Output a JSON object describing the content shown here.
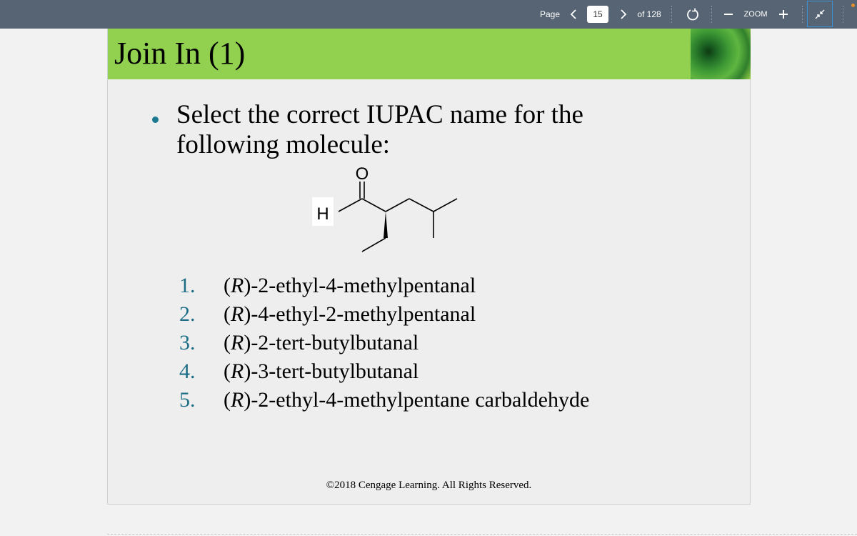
{
  "toolbar": {
    "page_label": "Page",
    "current_page": "15",
    "total_pages_label": "of 128",
    "zoom_label": "ZOOM",
    "prev_icon": "chevron-left-icon",
    "next_icon": "chevron-right-icon",
    "rotate_icon": "rotate-icon",
    "zoom_out_icon": "minus-icon",
    "zoom_in_icon": "plus-icon",
    "fit_icon": "collapse-arrows-icon",
    "accent_color": "#3e8fd0",
    "notification_color": "#e8902a"
  },
  "slide": {
    "title": "Join In (1)",
    "header_color": "#92d050",
    "question": "Select the correct IUPAC name for the following molecule:",
    "molecule": {
      "atom_O": "O",
      "atom_H": "H"
    },
    "options": [
      {
        "num": "1.",
        "prefix": "(",
        "stereo": "R",
        "text": ")-2-ethyl-4-methylpentanal"
      },
      {
        "num": "2.",
        "prefix": "(",
        "stereo": "R",
        "text": ")-4-ethyl-2-methylpentanal"
      },
      {
        "num": "3.",
        "prefix": "(",
        "stereo": "R",
        "text": ")-2-tert-butylbutanal"
      },
      {
        "num": "4.",
        "prefix": "(",
        "stereo": "R",
        "text": ")-3-tert-butylbutanal"
      },
      {
        "num": "5.",
        "prefix": "(",
        "stereo": "R",
        "text": ")-2-ethyl-4-methylpentane carbaldehyde"
      }
    ],
    "copyright": "©2018 Cengage Learning. All Rights Reserved."
  }
}
